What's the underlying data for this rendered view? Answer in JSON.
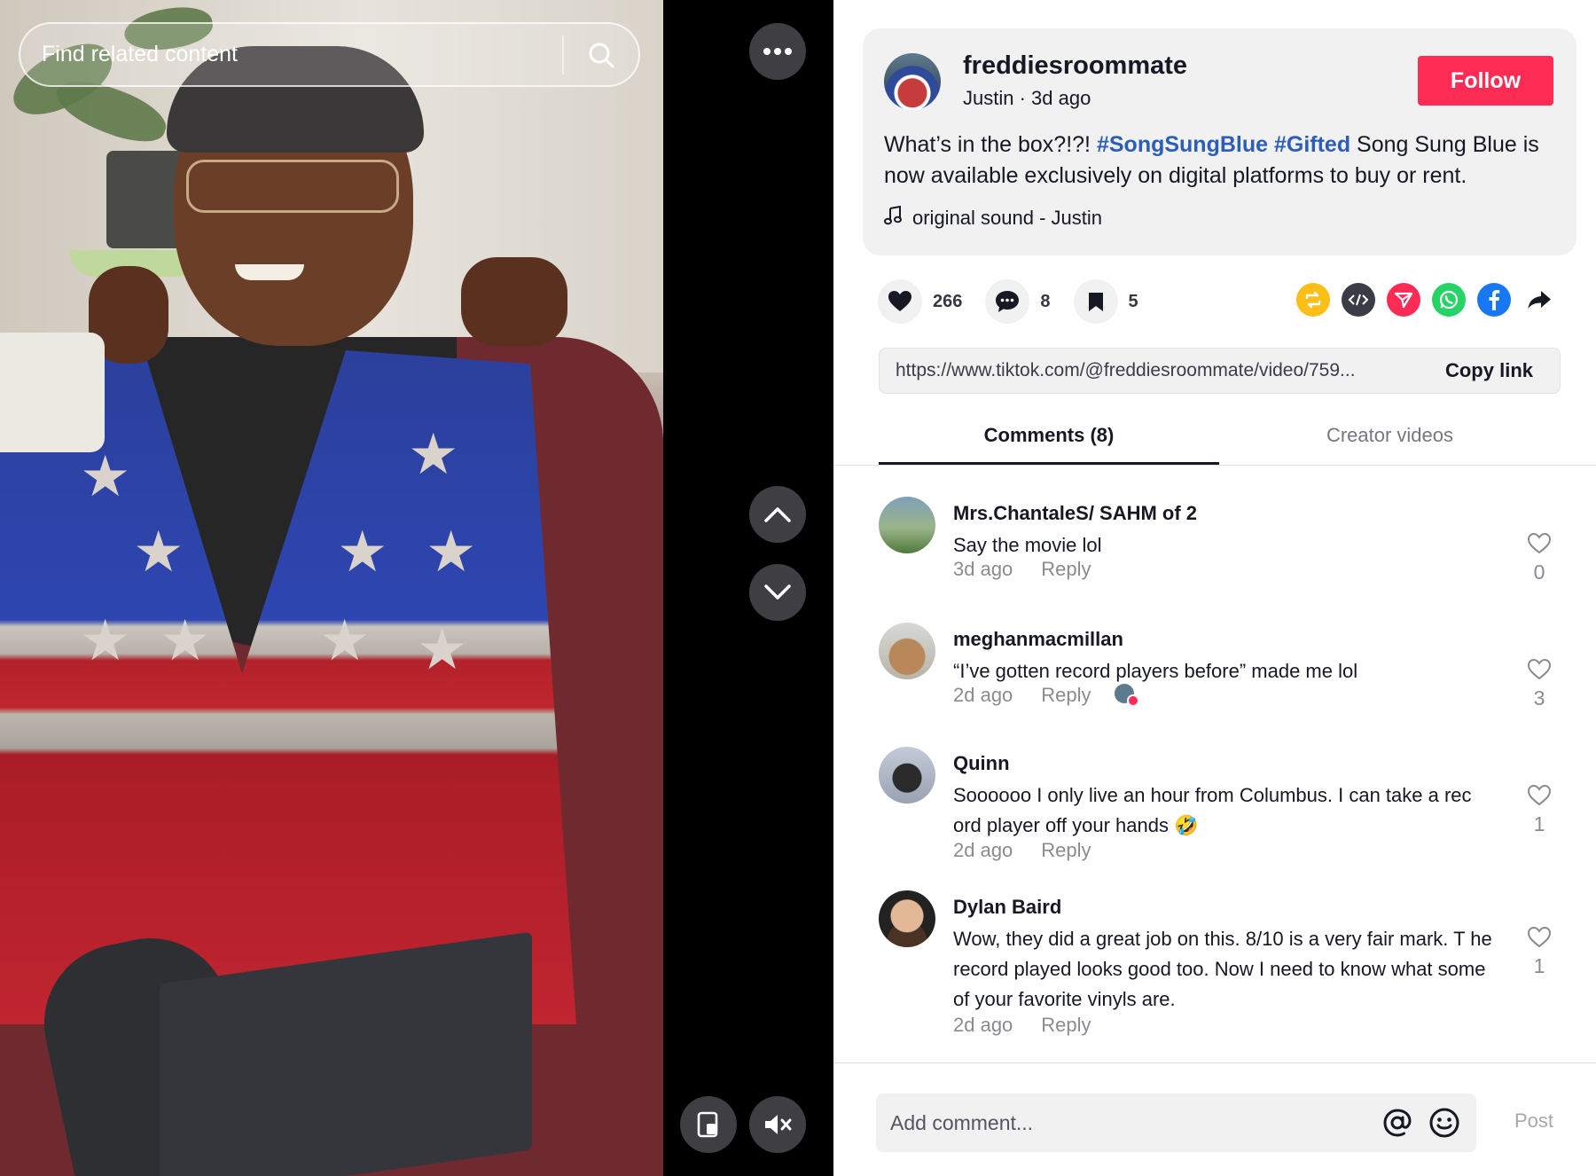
{
  "video": {
    "search_placeholder": "Find related content",
    "icons": {
      "search": "search-icon",
      "more": "more-icon",
      "prev": "chevron-up-icon",
      "next": "chevron-down-icon",
      "miniplayer": "miniplayer-icon",
      "mute": "muted-icon"
    }
  },
  "post": {
    "username": "freddiesroommate",
    "display_name": "Justin",
    "separator": " · ",
    "time": "3d ago",
    "follow_label": "Follow",
    "caption_prefix": "What’s in the box?!?! ",
    "hashtag1": "#SongSungBlue",
    "hashtag2": "#Gifted",
    "caption_suffix": " Song Sung Blue is now available exclusively on digital platforms to buy or rent.",
    "sound": "original sound - Justin"
  },
  "actions": {
    "likes": "266",
    "comments": "8",
    "saves": "5"
  },
  "share_icons": [
    "repost-icon",
    "embed-icon",
    "send-icon",
    "whatsapp-icon",
    "facebook-icon",
    "share-arrow-icon"
  ],
  "share_colors": {
    "repost": "#fcbf18",
    "embed": "#3b3c47",
    "send": "#fe2c55",
    "whatsapp": "#25d366",
    "facebook": "#1877f2"
  },
  "link": {
    "url": "https://www.tiktok.com/@freddiesroommate/video/759...",
    "copy_label": "Copy link"
  },
  "tabs": {
    "comments": "Comments (8)",
    "creator": "Creator videos"
  },
  "comments": [
    {
      "name": "Mrs.ChantaleS/ SAHM of 2",
      "text": "Say the movie lol",
      "time": "3d ago",
      "reply": "Reply",
      "likes": "0"
    },
    {
      "name": "meghanmacmillan",
      "text": "“I’ve gotten record players before” made me lol",
      "time": "2d ago",
      "reply": "Reply",
      "likes": "3"
    },
    {
      "name": "Quinn",
      "text": "Soooooo I only live an hour from Columbus. I can take a rec ord player off your hands 🤣",
      "time": "2d ago",
      "reply": "Reply",
      "likes": "1"
    },
    {
      "name": "Dylan Baird",
      "text": "Wow, they did a great job on this. 8/10 is a very fair mark. T he record played looks good too. Now I need to know what some of your favorite vinyls are.",
      "time": "2d ago",
      "reply": "Reply",
      "likes": "1"
    }
  ],
  "composer": {
    "placeholder": "Add comment...",
    "post_label": "Post"
  },
  "colors": {
    "accent": "#fe2c55",
    "hashtag": "#2b5db9"
  }
}
